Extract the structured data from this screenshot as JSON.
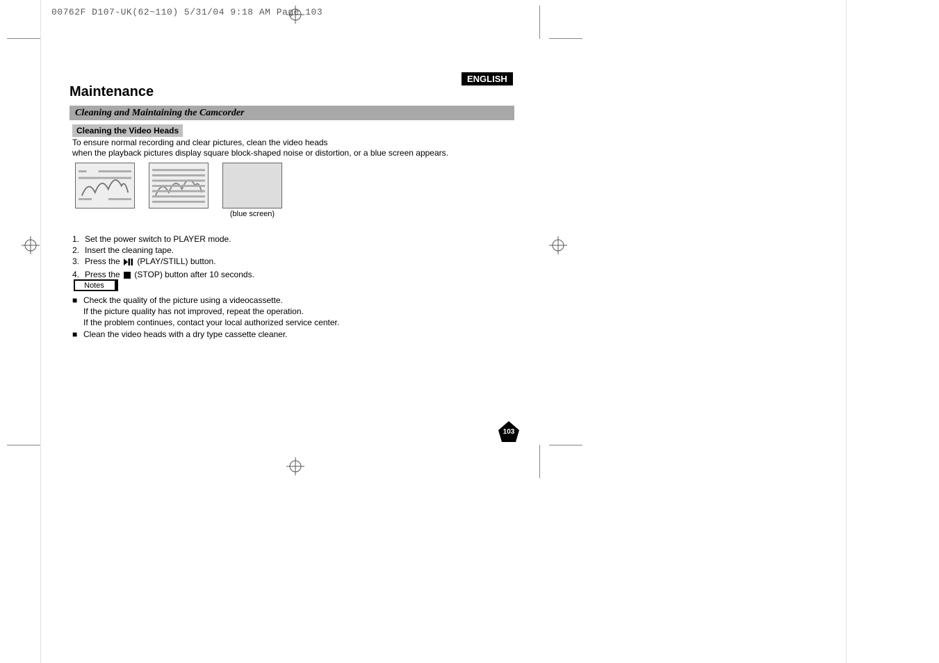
{
  "print_meta": "00762F D107-UK(62~110)  5/31/04 9:18 AM  Page 103",
  "language": "ENGLISH",
  "chapter_title": "Maintenance",
  "section_title": "Cleaning and Maintaining the Camcorder",
  "subheading": "Cleaning the Video Heads",
  "intro_lines": [
    "To ensure normal recording and clear pictures, clean the video heads",
    "when the playback pictures display square block-shaped noise or distortion, or a blue screen appears."
  ],
  "illustrations": [
    {
      "alt": "normal playback with partial noise",
      "caption": ""
    },
    {
      "alt": "playback with heavy block noise",
      "caption": ""
    },
    {
      "alt": "blue screen",
      "caption": "(blue screen)"
    }
  ],
  "steps": [
    {
      "n": "1.",
      "text": "Set the power switch to PLAYER mode."
    },
    {
      "n": "2.",
      "text": "Insert the cleaning tape."
    },
    {
      "n": "3.",
      "pre": "Press the ",
      "icon": "play-still",
      "post": "(PLAY/STILL) button."
    },
    {
      "n": "4.",
      "pre": "Press the ",
      "icon": "stop",
      "post": "(STOP) button after 10 seconds."
    }
  ],
  "notes_label": "Notes",
  "notes": [
    {
      "lines": [
        "Check the quality of the picture using a videocassette.",
        "If the picture quality has not improved, repeat the operation.",
        "If the problem continues, contact your local authorized service center."
      ]
    },
    {
      "lines": [
        "Clean the video heads with a dry type cassette cleaner."
      ]
    }
  ],
  "page_number": "103"
}
